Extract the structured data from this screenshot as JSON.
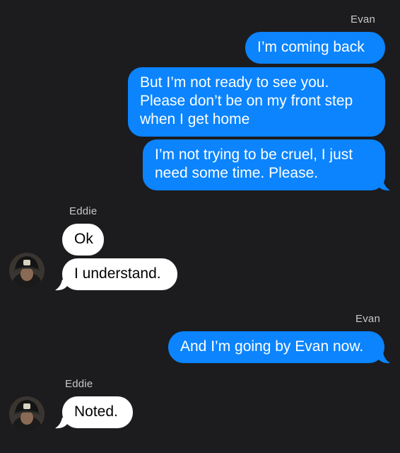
{
  "messages": {
    "evan_name_1": "Evan",
    "out_1": "I’m coming back",
    "out_2": "But I’m not ready to see you.\nPlease don’t be on my front step\nwhen I get home",
    "out_3": "I’m not trying to be cruel, I just\nneed some time. Please.",
    "eddie_name_1": "Eddie",
    "in_1": "Ok",
    "in_2": "I understand.",
    "evan_name_2": "Evan",
    "out_4": "And I’m going by Evan now.",
    "eddie_name_2": "Eddie",
    "in_3": "Noted."
  },
  "colors": {
    "background": "#1c1c1e",
    "outgoing_bubble": "#0b84fe",
    "incoming_bubble": "#ffffff",
    "sender_label": "#c7c7cc"
  },
  "icons": {
    "avatar": "firefighter-helmet-avatar-icon"
  }
}
